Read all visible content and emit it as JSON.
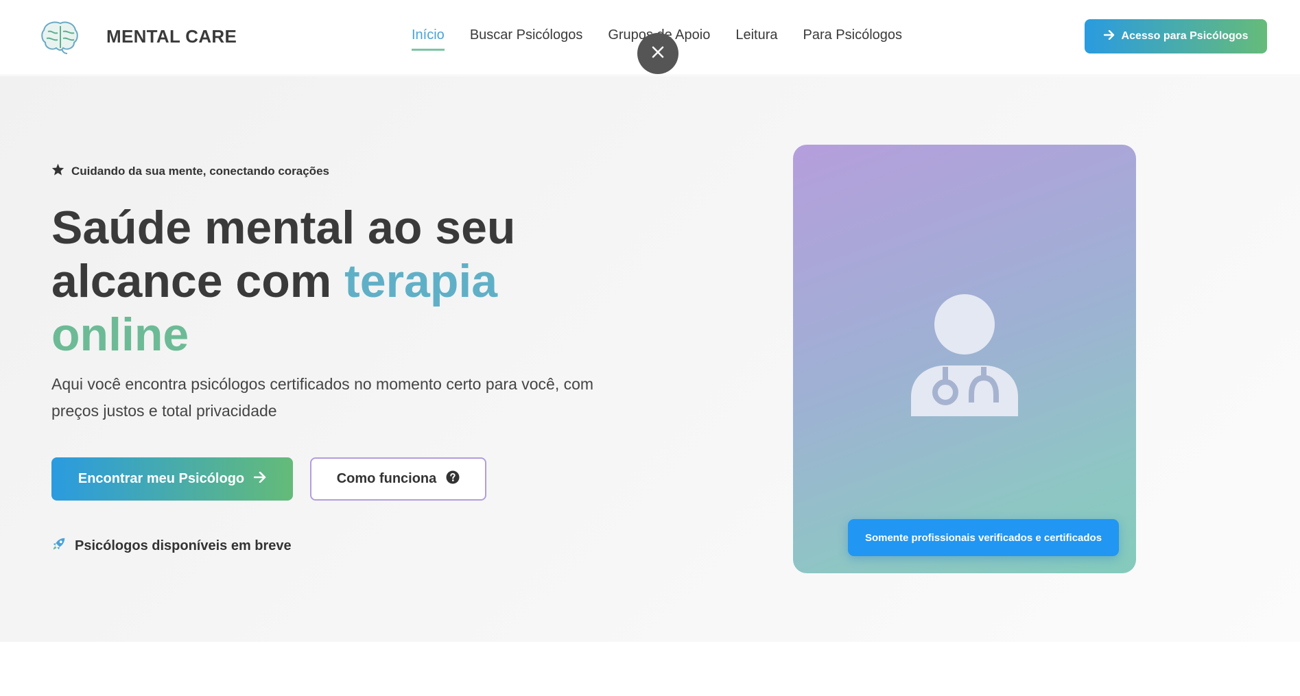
{
  "header": {
    "brand": "MENTAL CARE",
    "nav": [
      {
        "label": "Início",
        "active": true
      },
      {
        "label": "Buscar Psicólogos",
        "active": false
      },
      {
        "label": "Grupos de Apoio",
        "active": false
      },
      {
        "label": "Leitura",
        "active": false
      },
      {
        "label": "Para Psicólogos",
        "active": false
      }
    ],
    "access_button": "Acesso para Psicólogos"
  },
  "hero": {
    "tagline": "Cuidando da sua mente, conectando corações",
    "headline_part1": "Saúde mental ao seu alcance com ",
    "headline_highlight1": "terapia",
    "headline_highlight2": "online",
    "subtext": "Aqui você encontra psicólogos certificados no momento certo para você, com preços justos e total privacidade",
    "primary_cta": "Encontrar meu Psicólogo",
    "secondary_cta": "Como funciona",
    "availability_note": "Psicólogos disponíveis em breve",
    "verified_badge": "Somente profissionais verificados e certificados"
  },
  "icons": {
    "logo": "brain-logo-icon",
    "close": "close-icon",
    "arrow": "arrow-right-icon",
    "star": "star-icon",
    "question": "question-circle-icon",
    "rocket": "rocket-icon",
    "doctor": "doctor-icon"
  },
  "colors": {
    "accent_blue": "#2a9be0",
    "accent_green": "#66bb7a",
    "nav_active": "#4aa3d8",
    "secondary_border": "#b29ddc",
    "badge_blue": "#2196f3"
  }
}
